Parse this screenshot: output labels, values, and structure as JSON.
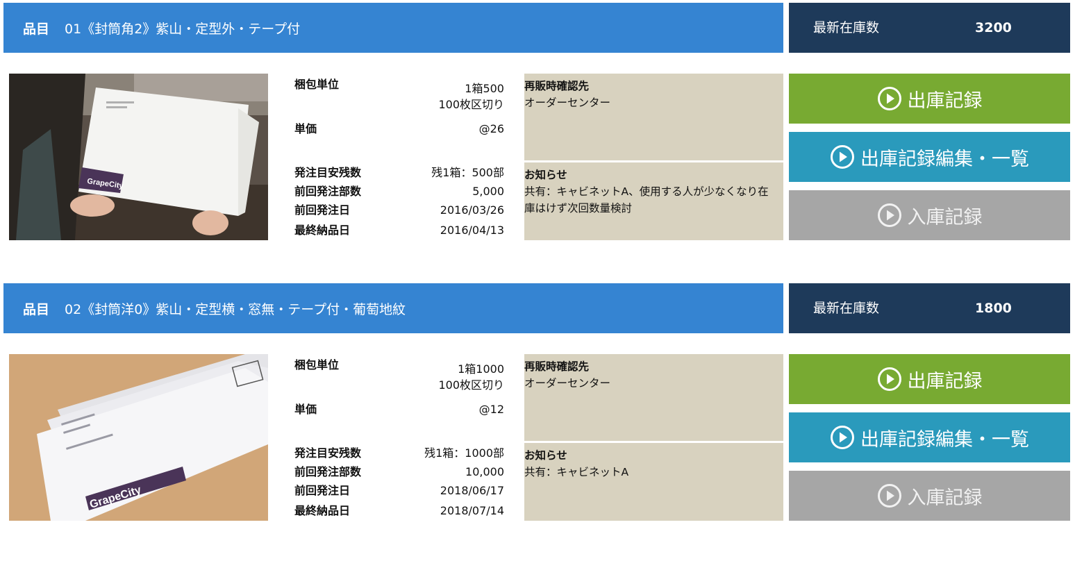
{
  "items": [
    {
      "title_label": "品目",
      "title": "01《封筒角2》紫山・定型外・テープ付",
      "stock_label": "最新在庫数",
      "stock_value": "3200",
      "specs": {
        "pack_label": "梱包単位",
        "pack_value_1": "1箱500",
        "pack_value_2": "100枚区切り",
        "price_label": "単価",
        "price_value": "@26",
        "reorder_label": "発注目安残数",
        "reorder_value": "残1箱：500部",
        "last_qty_label": "前回発注部数",
        "last_qty_value": "5,000",
        "last_date_label": "前回発注日",
        "last_date_value": "2016/03/26",
        "delivery_label": "最終納品日",
        "delivery_value": "2016/04/13"
      },
      "contact_heading": "再販時確認先",
      "contact_text": "オーダーセンター",
      "notice_heading": "お知らせ",
      "notice_text": "共有：キャビネットA、使用する人が少なくなり在庫はけず次回数量検討",
      "buttons": {
        "out": "出庫記録",
        "list": "出庫記録編集・一覧",
        "in": "入庫記録"
      }
    },
    {
      "title_label": "品目",
      "title": "02《封筒洋0》紫山・定型横・窓無・テープ付・葡萄地紋",
      "stock_label": "最新在庫数",
      "stock_value": "1800",
      "specs": {
        "pack_label": "梱包単位",
        "pack_value_1": "1箱1000",
        "pack_value_2": "100枚区切り",
        "price_label": "単価",
        "price_value": "@12",
        "reorder_label": "発注目安残数",
        "reorder_value": "残1箱：1000部",
        "last_qty_label": "前回発注部数",
        "last_qty_value": "10,000",
        "last_date_label": "前回発注日",
        "last_date_value": "2018/06/17",
        "delivery_label": "最終納品日",
        "delivery_value": "2018/07/14"
      },
      "contact_heading": "再販時確認先",
      "contact_text": "オーダーセンター",
      "notice_heading": "お知らせ",
      "notice_text": "共有：キャビネットA",
      "buttons": {
        "out": "出庫記録",
        "list": "出庫記録編集・一覧",
        "in": "入庫記録"
      }
    }
  ],
  "photo_brand": "GrapeCity",
  "colors": {
    "title_bar": "#3584d2",
    "stock_bar": "#1e3a5a",
    "note_box": "#d8d2bf",
    "btn_out": "#78aa32",
    "btn_list": "#2a9abc",
    "btn_in": "#a6a6a6"
  },
  "icons": {
    "button": "play-circle-icon"
  }
}
